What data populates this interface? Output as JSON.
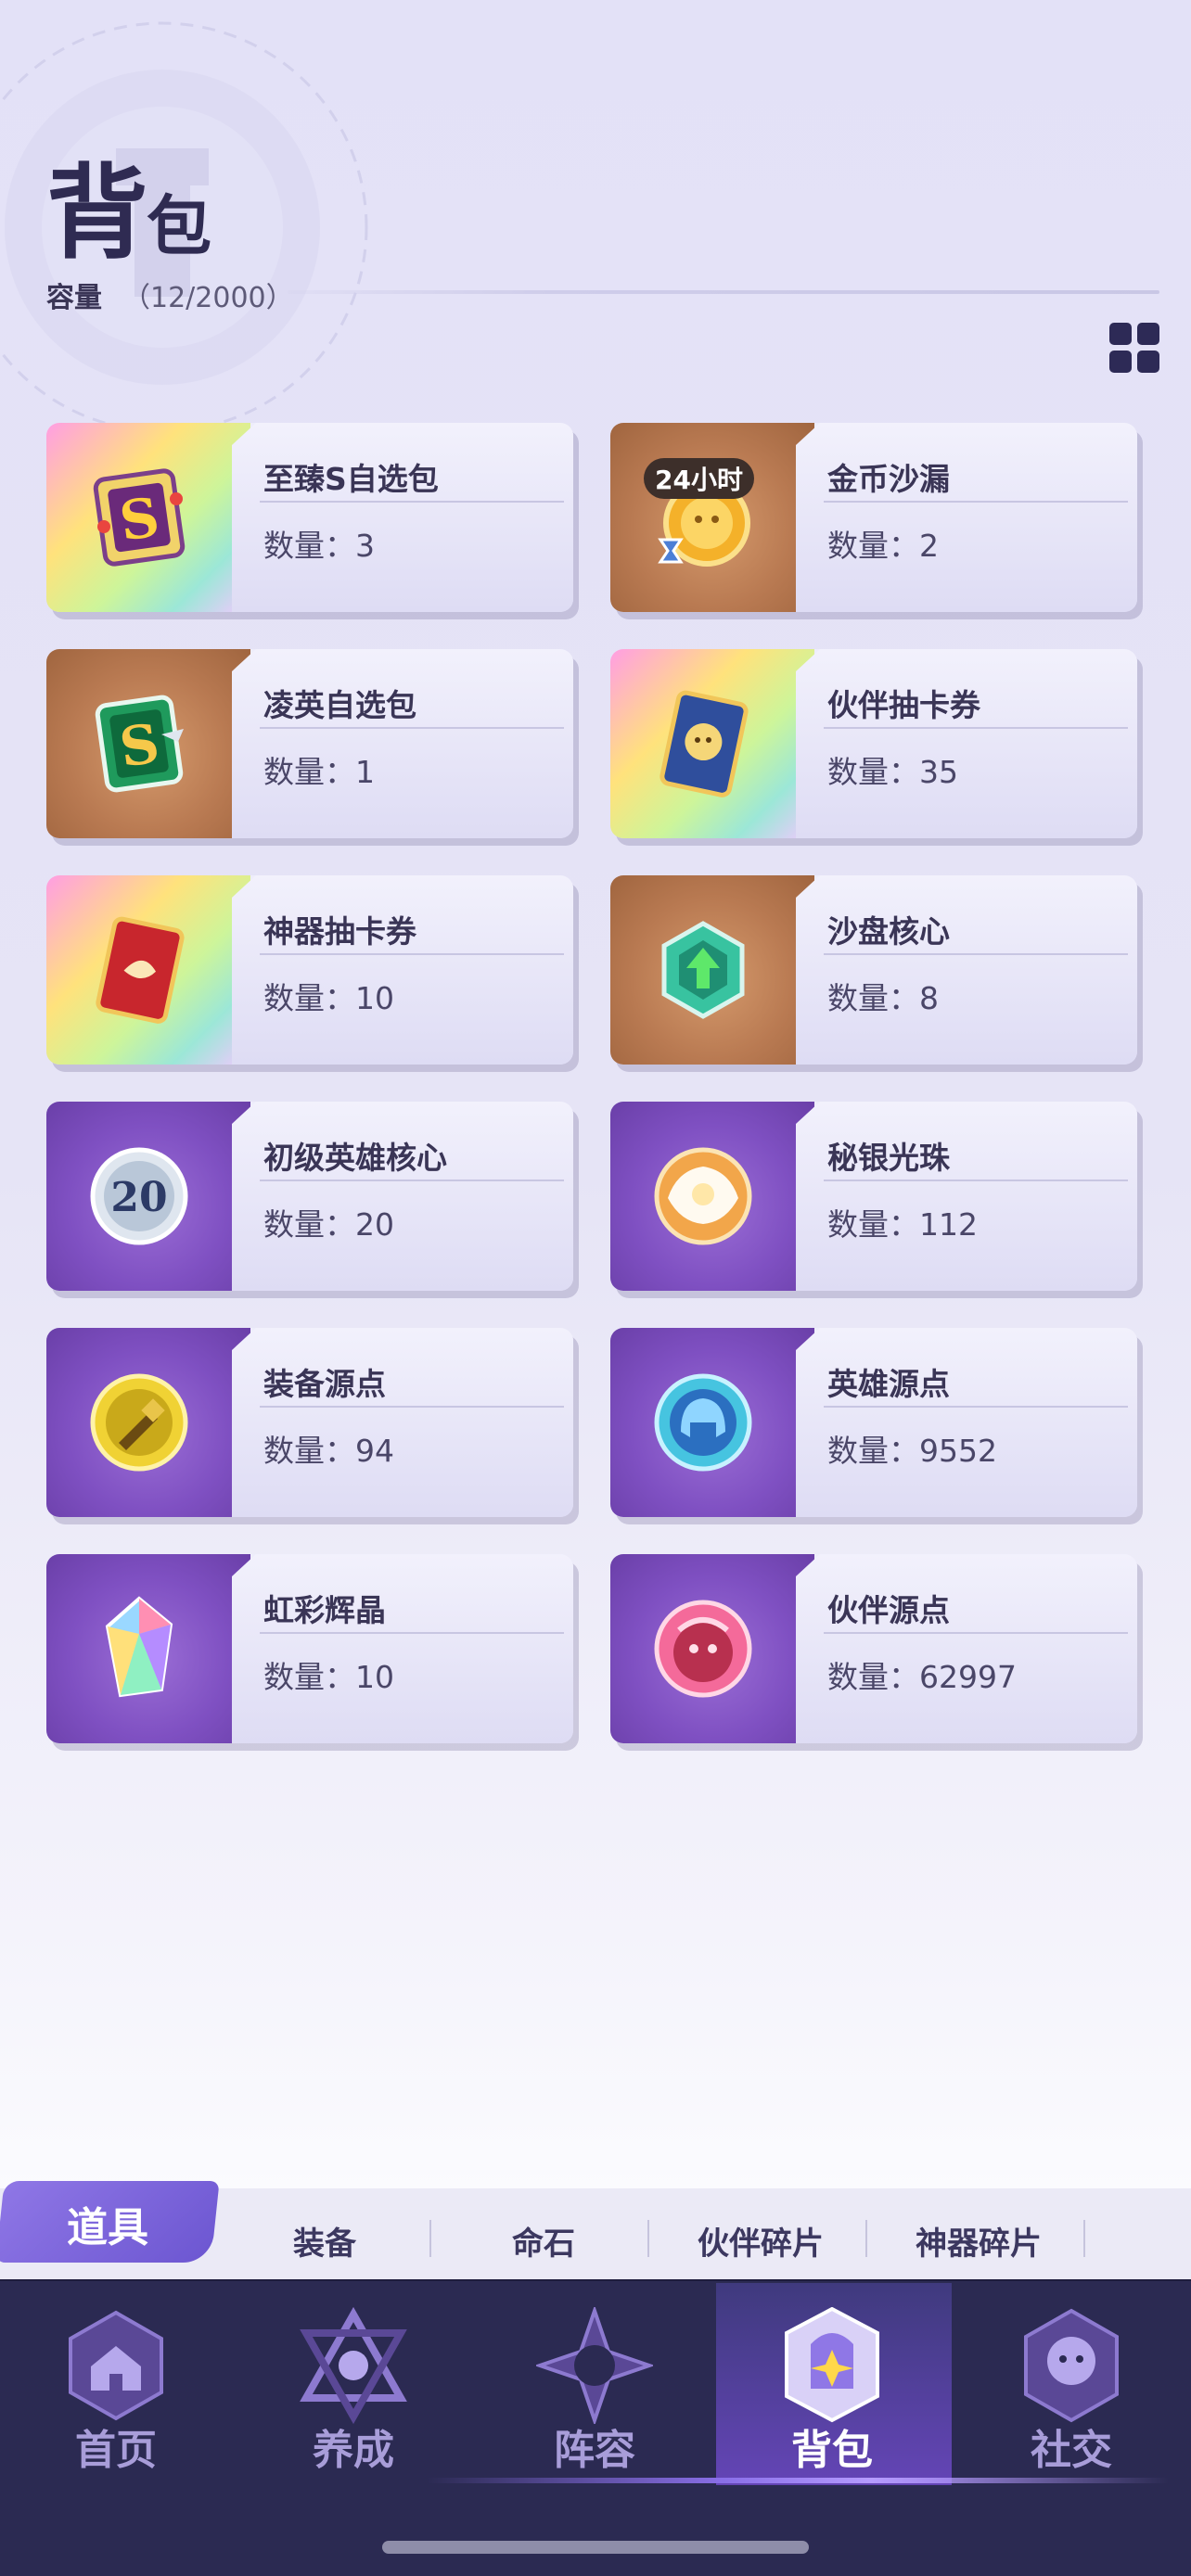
{
  "header": {
    "title_big": "背",
    "title_small": "包",
    "capacity_label": "容量",
    "capacity_value": "（12/2000）"
  },
  "items": [
    {
      "name": "至臻S自选包",
      "qty": "数量：3",
      "icon": "s-card-pack-icon",
      "bg": "rainbow"
    },
    {
      "name": "金币沙漏",
      "qty": "数量：2",
      "icon": "gold-hourglass-icon",
      "bg": "bronze",
      "badge": "24小时"
    },
    {
      "name": "凌英自选包",
      "qty": "数量：1",
      "icon": "green-s-pack-icon",
      "bg": "bronze"
    },
    {
      "name": "伙伴抽卡券",
      "qty": "数量：35",
      "icon": "partner-card-icon",
      "bg": "rainbow"
    },
    {
      "name": "神器抽卡券",
      "qty": "数量：10",
      "icon": "artifact-card-icon",
      "bg": "rainbow"
    },
    {
      "name": "沙盘核心",
      "qty": "数量：8",
      "icon": "sandbox-core-icon",
      "bg": "bronze"
    },
    {
      "name": "初级英雄核心",
      "qty": "数量：20",
      "icon": "hero-core-icon",
      "bg": "purple",
      "icon_text": "20"
    },
    {
      "name": "秘银光珠",
      "qty": "数量：112",
      "icon": "mithril-orb-icon",
      "bg": "purple"
    },
    {
      "name": "装备源点",
      "qty": "数量：94",
      "icon": "equipment-source-icon",
      "bg": "purple"
    },
    {
      "name": "英雄源点",
      "qty": "数量：9552",
      "icon": "hero-source-icon",
      "bg": "purple"
    },
    {
      "name": "虹彩辉晶",
      "qty": "数量：10",
      "icon": "rainbow-crystal-icon",
      "bg": "purple"
    },
    {
      "name": "伙伴源点",
      "qty": "数量：62997",
      "icon": "partner-source-icon",
      "bg": "purple"
    }
  ],
  "subtabs": {
    "active": "道具",
    "others": [
      "装备",
      "命石",
      "伙伴碎片",
      "神器碎片"
    ]
  },
  "nav": [
    {
      "label": "首页",
      "icon": "home-icon"
    },
    {
      "label": "养成",
      "icon": "growth-icon"
    },
    {
      "label": "阵容",
      "icon": "lineup-icon"
    },
    {
      "label": "背包",
      "icon": "backpack-icon",
      "active": true
    },
    {
      "label": "社交",
      "icon": "social-icon"
    }
  ],
  "colors": {
    "accent": "#6c56d1",
    "nav_bg": "#2b2a52",
    "title": "#2f2b52"
  }
}
